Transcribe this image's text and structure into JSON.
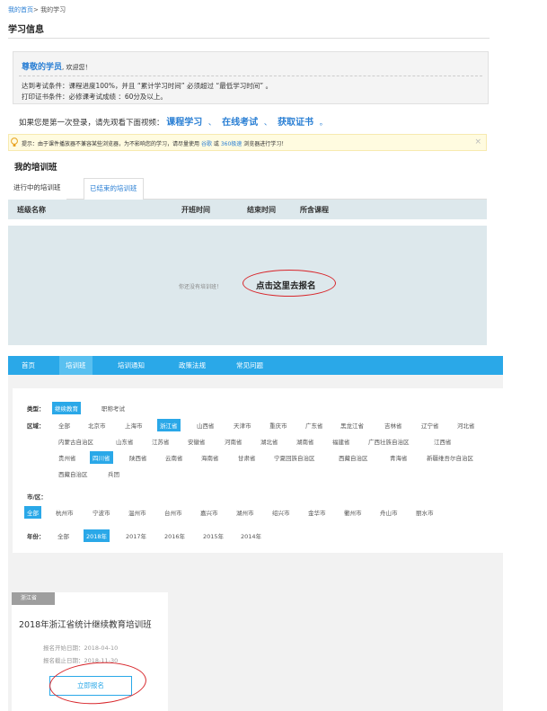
{
  "breadcrumb": {
    "home": "我的首页",
    "sep": ">",
    "current": "我的学习"
  },
  "page_title": "学习信息",
  "welcome": {
    "greeting": "尊敬的学员",
    "greeting_suffix": ", 欢迎您！",
    "line1": "达到考试条件：课程进度100%，并且 “累计学习时间” 必须超过 “最低学习时间” 。",
    "line2": "打印证书条件：必修课考试成绩 ：60分及以上。"
  },
  "video_hint": {
    "prefix": "如果您是第一次登录，请先观看下面视频：",
    "links": [
      "课程学习",
      "在线考试",
      "获取证书"
    ],
    "sep": "、",
    "suffix": "。"
  },
  "tip": {
    "text_a": "提示：由于课件播放器不兼容某些浏览器，为不影响您的学习，请尽量使用",
    "browser1": "谷歌",
    "or": "或",
    "browser2": "360极速",
    "text_b": "浏览器进行学习！",
    "close": "×"
  },
  "classes": {
    "title": "我的培训班",
    "tabs": [
      "进行中的培训班",
      "已结束的培训班"
    ],
    "columns": [
      "班级名称",
      "开班时间",
      "结束时间",
      "所含课程"
    ],
    "empty_text": "你还没有培训班！",
    "signup_text": "点击这里去报名"
  },
  "nav": {
    "items": [
      "首页",
      "培训班",
      "培训通知",
      "政策法规",
      "常见问题"
    ],
    "active": 1
  },
  "filter": {
    "type_label": "类型：",
    "types": [
      "继续教育",
      "职称考试"
    ],
    "type_selected": 0,
    "region_label": "区域：",
    "regions_row1": [
      "全部",
      "北京市",
      "上海市",
      "浙江省",
      "山西省",
      "天津市",
      "重庆市",
      "广东省",
      "黑龙江省",
      "吉林省",
      "辽宁省",
      "河北省"
    ],
    "regions_row2": [
      "内蒙古自治区",
      "山东省",
      "江苏省",
      "安徽省",
      "河南省",
      "湖北省",
      "湖南省",
      "福建省",
      "广西壮族自治区",
      "江西省"
    ],
    "regions_row3": [
      "贵州省",
      "四川省",
      "陕西省",
      "云南省",
      "海南省",
      "甘肃省",
      "宁夏回族自治区",
      "西藏自治区",
      "青海省",
      "新疆维吾尔自治区"
    ],
    "regions_row4": [
      "西藏自治区",
      "兵团"
    ],
    "region_selected": [
      "浙江省",
      "四川省"
    ],
    "city_label": "市/区：",
    "cities": [
      "全部",
      "杭州市",
      "宁波市",
      "温州市",
      "台州市",
      "嘉兴市",
      "湖州市",
      "绍兴市",
      "金华市",
      "衢州市",
      "舟山市",
      "丽水市"
    ],
    "city_selected": 0,
    "year_label": "年份：",
    "years": [
      "全部",
      "2018年",
      "2017年",
      "2016年",
      "2015年",
      "2014年"
    ],
    "year_selected": 1
  },
  "card": {
    "province": "浙江省",
    "title": "2018年浙江省统计继续教育培训班",
    "start_label": "报名开始日期：",
    "start_date": "2018-04-10",
    "end_label": "报名截止日期：",
    "end_date": "2018-11-30",
    "button": "立即报名"
  },
  "colors": {
    "accent": "#2aa8e8",
    "link": "#2a7fd4",
    "highlight_oval": "#d8262b"
  }
}
